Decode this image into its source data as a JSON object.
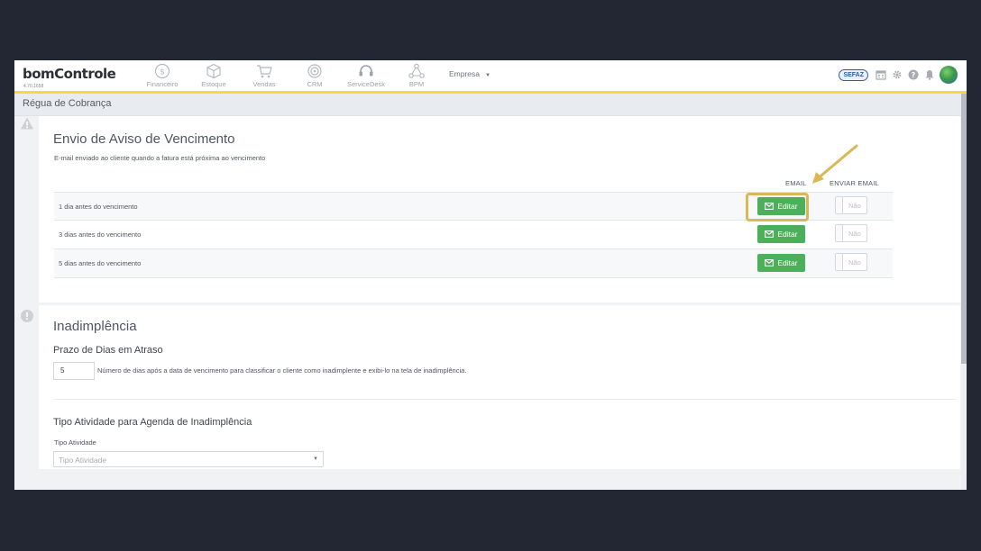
{
  "app": {
    "logo": "bomControle",
    "version": "4.70.1658"
  },
  "nav": {
    "items": [
      {
        "label": "Financeiro",
        "icon": "dollar-circle-icon"
      },
      {
        "label": "Estoque",
        "icon": "box-icon"
      },
      {
        "label": "Vendas",
        "icon": "cart-icon"
      },
      {
        "label": "CRM",
        "icon": "target-icon"
      },
      {
        "label": "ServiceDesk",
        "icon": "headset-icon"
      },
      {
        "label": "BPM",
        "icon": "workflow-icon"
      }
    ],
    "company_label": "Empresa",
    "right_icons": [
      "sefaz-badge",
      "calendar-icon",
      "gear-icon",
      "help-icon",
      "bell-icon",
      "avatar"
    ],
    "sefaz_label": "SEFAZ",
    "accent_color": "#f2dc3a"
  },
  "page": {
    "title": "Régua de Cobrança"
  },
  "aviso": {
    "title": "Envio de Aviso de Vencimento",
    "description": "E-mail enviado ao cliente quando a fatura está próxima ao vencimento",
    "col_email": "EMAIL",
    "col_enviar": "ENVIAR EMAIL",
    "rows": [
      {
        "label": "1 dia antes do vencimento",
        "button": "Editar",
        "toggle": "Não"
      },
      {
        "label": "3 dias antes do vencimento",
        "button": "Editar",
        "toggle": "Não"
      },
      {
        "label": "5 dias antes do vencimento",
        "button": "Editar",
        "toggle": "Não"
      }
    ],
    "button_color": "#4cb05a",
    "highlight_color": "#d9b955"
  },
  "inadimplencia": {
    "title": "Inadimplência",
    "prazo_title": "Prazo de Dias em Atraso",
    "prazo_value": "5",
    "prazo_desc": "Número de dias após a data de vencimento para classificar o cliente como inadimplente e exibi-lo na tela de inadimplência.",
    "tipo_title": "Tipo Atividade para Agenda de Inadimplência",
    "tipo_label": "Tipo Atividade",
    "tipo_placeholder": "Tipo Atividade"
  }
}
